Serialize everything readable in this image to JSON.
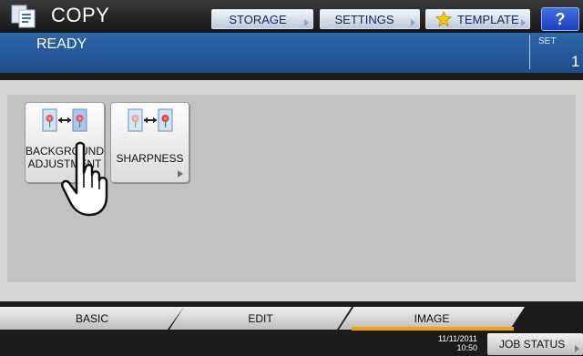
{
  "header": {
    "title": "COPY",
    "buttons": {
      "storage": "STORAGE",
      "settings": "SETTINGS",
      "template": "TEMPLATE",
      "help": "?"
    }
  },
  "status": {
    "text": "READY",
    "set_label": "SET",
    "set_value": "1"
  },
  "functions": [
    {
      "label_line1": "BACKGROUND",
      "label_line2": "ADJUSTMENT",
      "icon": "page-arrow-page-icon"
    },
    {
      "label_line1": "SHARPNESS",
      "icon": "page-arrow-page-icon"
    }
  ],
  "tabs": [
    {
      "label": "BASIC",
      "active": false
    },
    {
      "label": "EDIT",
      "active": false
    },
    {
      "label": "IMAGE",
      "active": true
    }
  ],
  "footer": {
    "date": "11/11/2011",
    "time": "10:50",
    "job_status": "JOB STATUS"
  },
  "colors": {
    "status_bar": "#1c4c8e",
    "active_tab_underline": "#f2a400",
    "help_button": "#2a52cc"
  }
}
